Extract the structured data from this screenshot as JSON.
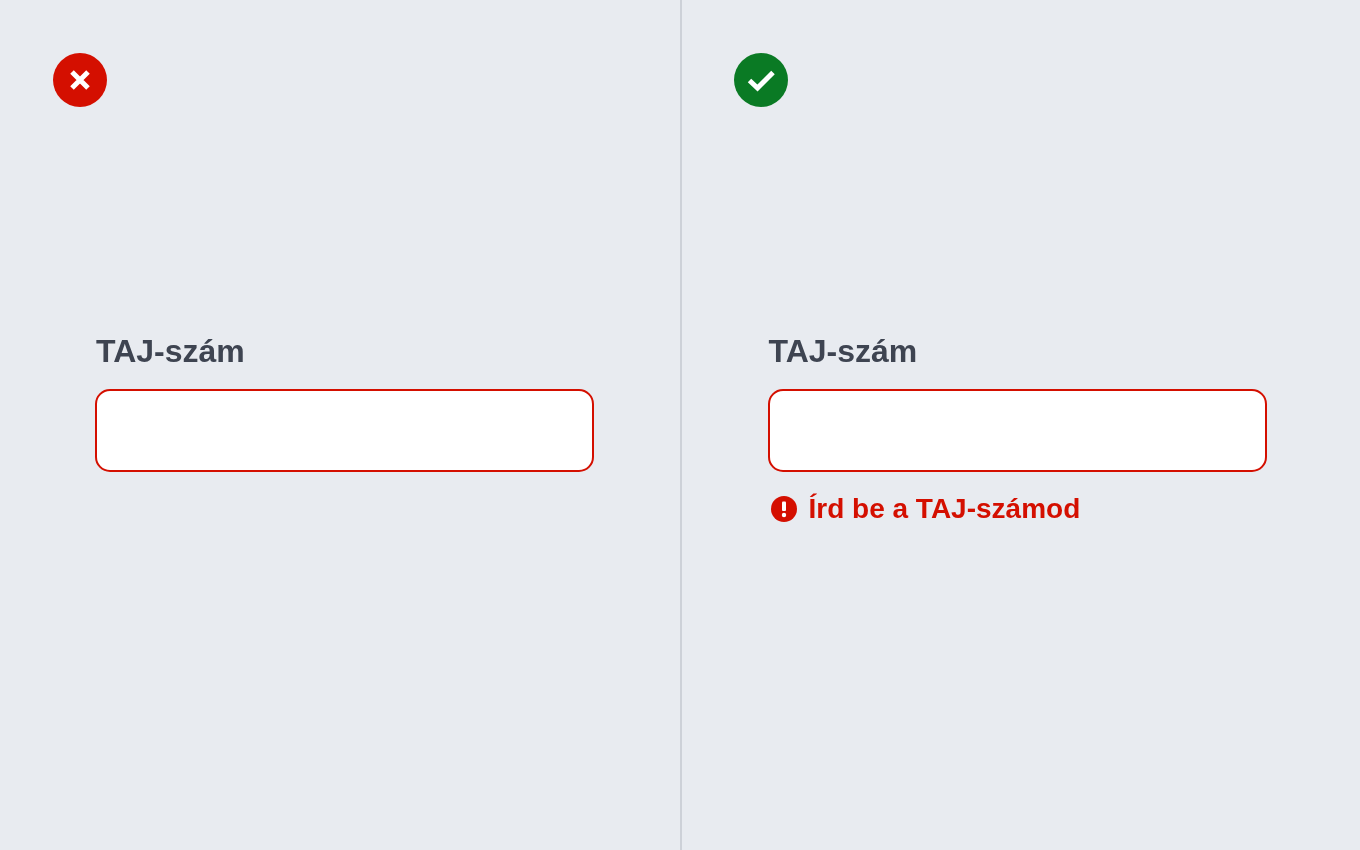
{
  "panels": [
    {
      "kind": "incorrect",
      "field": {
        "label": "TAJ-szám",
        "invalid": true
      }
    },
    {
      "kind": "correct",
      "field": {
        "label": "TAJ-szám",
        "invalid": true
      },
      "error": "Írd be a TAJ-számod"
    }
  ]
}
